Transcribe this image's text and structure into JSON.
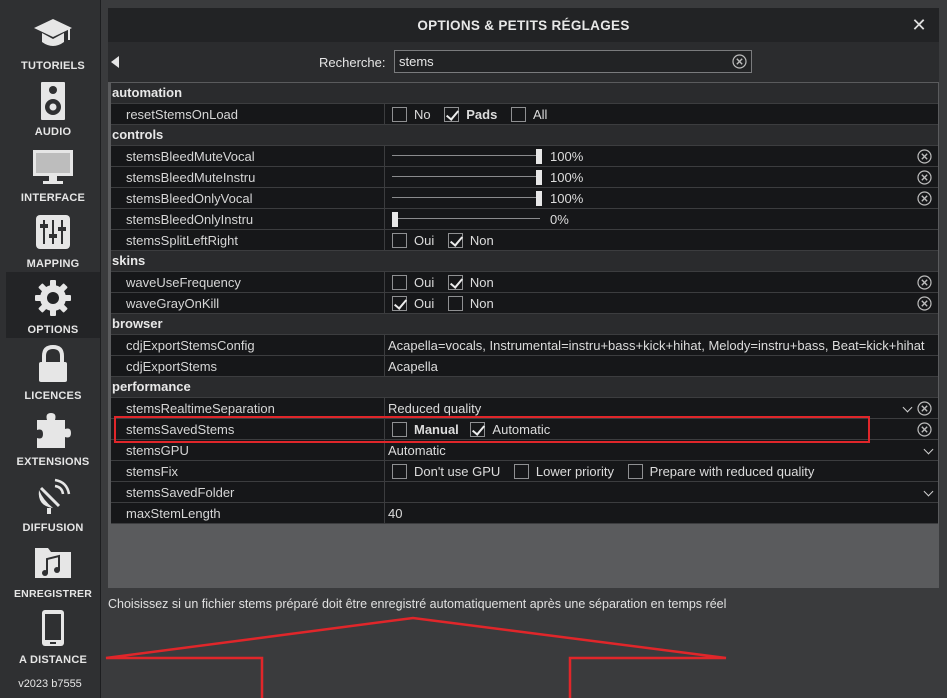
{
  "sidebar": {
    "items": [
      {
        "label": "TUTORIELS",
        "icon": "graduation-cap-icon"
      },
      {
        "label": "AUDIO",
        "icon": "speaker-icon"
      },
      {
        "label": "INTERFACE",
        "icon": "monitor-icon"
      },
      {
        "label": "MAPPING",
        "icon": "sliders-icon"
      },
      {
        "label": "OPTIONS",
        "icon": "gear-icon"
      },
      {
        "label": "LICENCES",
        "icon": "lock-icon"
      },
      {
        "label": "EXTENSIONS",
        "icon": "puzzle-icon"
      },
      {
        "label": "DIFFUSION",
        "icon": "satellite-dish-icon"
      },
      {
        "label": "ENREGISTRER",
        "icon": "music-folder-icon"
      },
      {
        "label": "A DISTANCE",
        "icon": "tablet-icon"
      }
    ],
    "version": "v2023 b7555"
  },
  "panel": {
    "title": "OPTIONS & PETITS RÉGLAGES",
    "close": "✕"
  },
  "search": {
    "label": "Recherche:",
    "value": "stems"
  },
  "sections": {
    "automation": "automation",
    "controls": "controls",
    "skins": "skins",
    "browser": "browser",
    "performance": "performance"
  },
  "rows": {
    "resetStemsOnLoad": {
      "name": "resetStemsOnLoad",
      "opt1": "No",
      "opt2": "Pads",
      "opt3": "All"
    },
    "stemsBleedMuteVocal": {
      "name": "stemsBleedMuteVocal",
      "value": "100%",
      "level": 1.0
    },
    "stemsBleedMuteInstru": {
      "name": "stemsBleedMuteInstru",
      "value": "100%",
      "level": 1.0
    },
    "stemsBleedOnlyVocal": {
      "name": "stemsBleedOnlyVocal",
      "value": "100%",
      "level": 1.0
    },
    "stemsBleedOnlyInstru": {
      "name": "stemsBleedOnlyInstru",
      "value": "0%",
      "level": 0.0
    },
    "stemsSplitLeftRight": {
      "name": "stemsSplitLeftRight",
      "opt1": "Oui",
      "opt2": "Non"
    },
    "waveUseFrequency": {
      "name": "waveUseFrequency",
      "opt1": "Oui",
      "opt2": "Non"
    },
    "waveGrayOnKill": {
      "name": "waveGrayOnKill",
      "opt1": "Oui",
      "opt2": "Non"
    },
    "cdjExportStemsConfig": {
      "name": "cdjExportStemsConfig",
      "value": "Acapella=vocals, Instrumental=instru+bass+kick+hihat, Melody=instru+bass, Beat=kick+hihat"
    },
    "cdjExportStems": {
      "name": "cdjExportStems",
      "value": "Acapella"
    },
    "stemsRealtimeSeparation": {
      "name": "stemsRealtimeSeparation",
      "value": "Reduced quality"
    },
    "stemsSavedStems": {
      "name": "stemsSavedStems",
      "opt1": "Manual",
      "opt2": "Automatic"
    },
    "stemsGPU": {
      "name": "stemsGPU",
      "value": "Automatic"
    },
    "stemsFix": {
      "name": "stemsFix",
      "opt1": "Don't use GPU",
      "opt2": "Lower priority",
      "opt3": "Prepare with reduced quality"
    },
    "stemsSavedFolder": {
      "name": "stemsSavedFolder",
      "value": ""
    },
    "maxStemLength": {
      "name": "maxStemLength",
      "value": "40"
    }
  },
  "help_text": "Choisissez si un fichier stems préparé doit être enregistré automatiquement après une séparation en temps réel",
  "colors": {
    "annotation_red": "#e0262a",
    "background": "#3a3b3d",
    "row_bg": "#161719"
  }
}
